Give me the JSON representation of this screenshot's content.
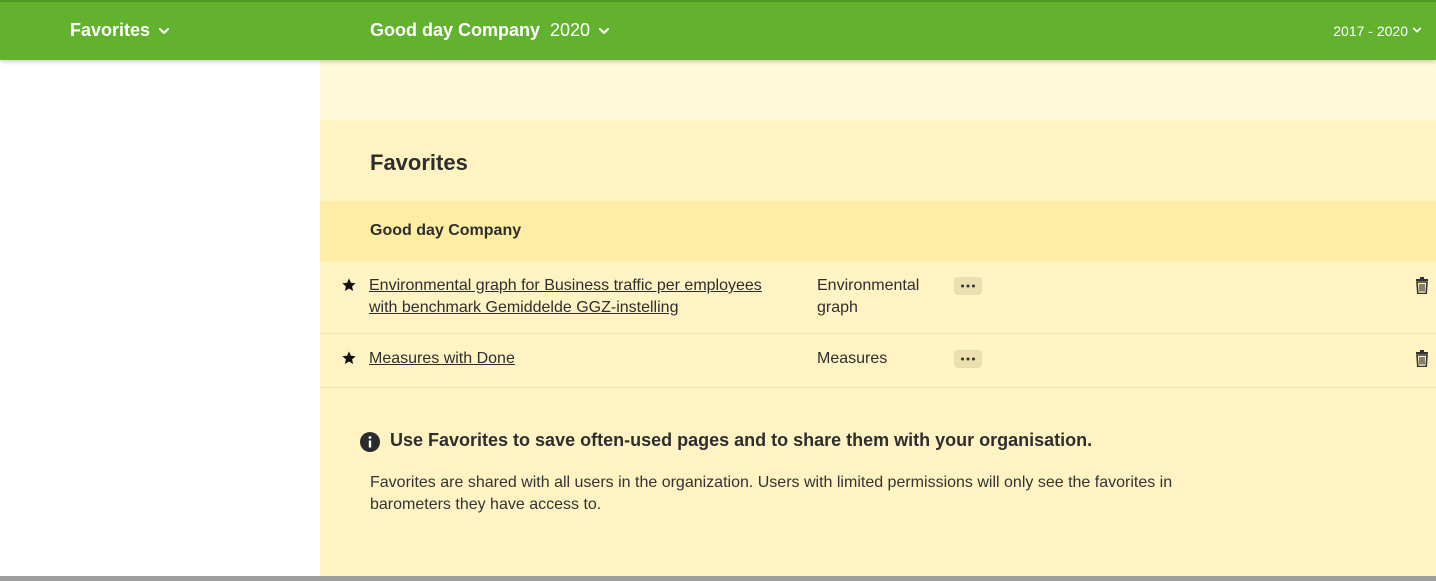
{
  "header": {
    "favorites_menu": "Favorites",
    "company": "Good day Company",
    "year": "2020",
    "range": "2017 - 2020"
  },
  "main": {
    "title": "Favorites",
    "group_name": "Good day Company",
    "rows": [
      {
        "link": "Environmental graph for Business traffic per employees with benchmark Gemiddelde GGZ-instelling",
        "type": "Environmental graph"
      },
      {
        "link": "Measures with Done",
        "type": "Measures"
      }
    ],
    "info": {
      "title": "Use Favorites to save often-used pages and to share them with your organisation.",
      "text": "Favorites are shared with all users in the organization. Users with limited permissions will only see the favorites in barometers they have access to."
    }
  },
  "icons": {
    "star": "star-icon",
    "more": "more-icon",
    "trash": "trash-icon",
    "info": "info-icon",
    "chevron": "chevron-down-icon"
  },
  "colors": {
    "header_green": "#62b22f",
    "panel_yellow": "#fff3c4",
    "group_yellow": "#ffeda3"
  }
}
